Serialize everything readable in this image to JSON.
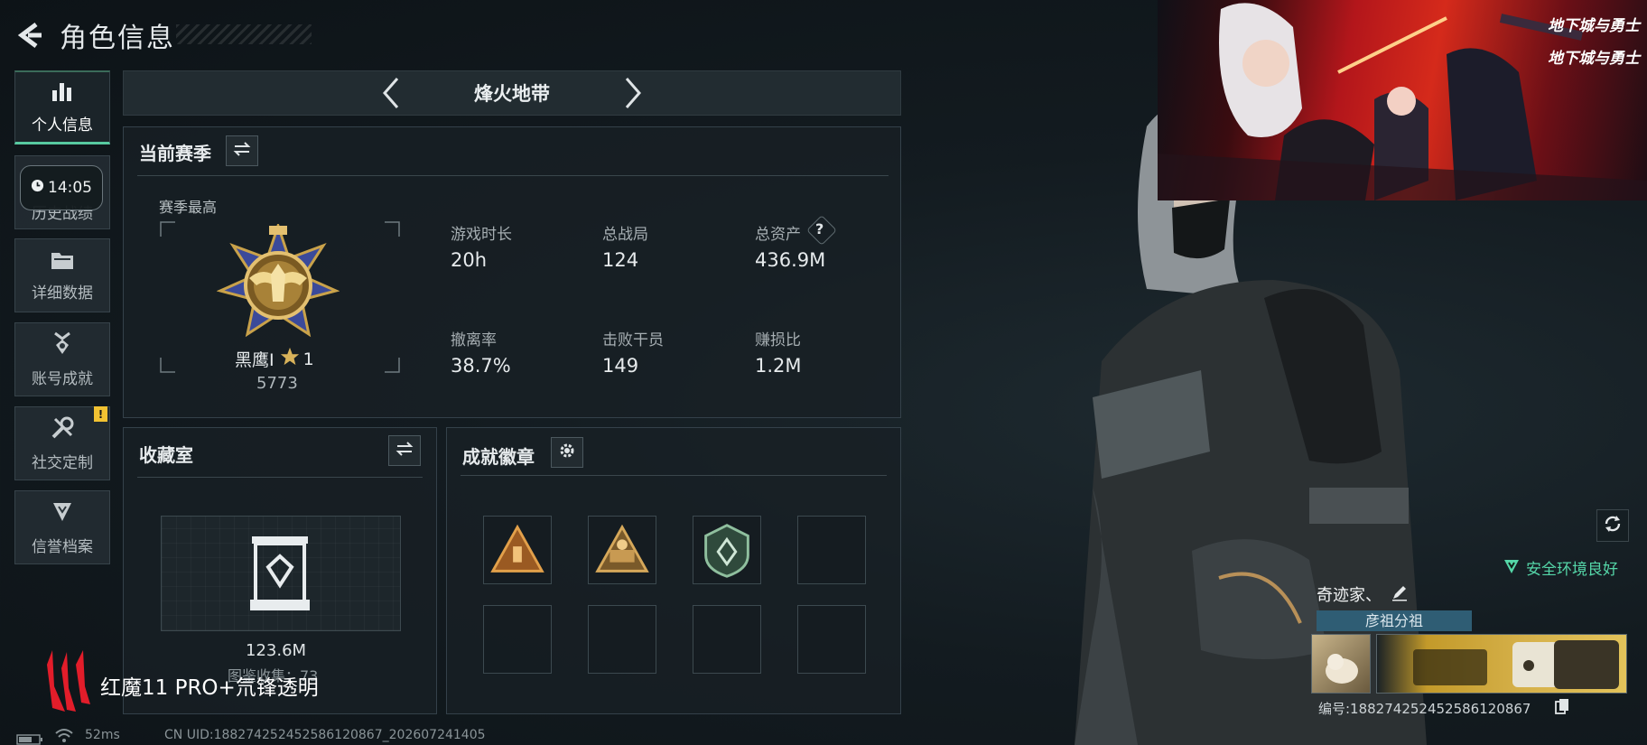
{
  "header": {
    "title": "角色信息"
  },
  "nav": {
    "items": [
      {
        "label": "个人信息",
        "icon": "bar-chart-icon"
      },
      {
        "label": "历史战绩",
        "icon": "clock-icon"
      },
      {
        "label": "详细数据",
        "icon": "folder-icon"
      },
      {
        "label": "账号成就",
        "icon": "medal-icon"
      },
      {
        "label": "社交定制",
        "icon": "wrench-icon"
      },
      {
        "label": "信誉档案",
        "icon": "shield-icon"
      }
    ],
    "clock_time": "14:05",
    "warn_badge": "!"
  },
  "map_bar": {
    "name": "烽火地带"
  },
  "season": {
    "title": "当前赛季",
    "best_label": "赛季最高",
    "rank_name": "黑鹰I",
    "rank_stars": "1",
    "rank_score": "5773",
    "stats": [
      {
        "label": "游戏时长",
        "value": "20h"
      },
      {
        "label": "总战局",
        "value": "124"
      },
      {
        "label": "总资产",
        "value": "436.9M"
      },
      {
        "label": "撤离率",
        "value": "38.7%"
      },
      {
        "label": "击败干员",
        "value": "149"
      },
      {
        "label": "赚损比",
        "value": "1.2M"
      }
    ],
    "help_mark": "?"
  },
  "collection": {
    "title": "收藏室",
    "value": "123.6M",
    "sub_label": "图鉴收集：73"
  },
  "achievements": {
    "title": "成就徽章"
  },
  "character": {
    "name": "奇迹家、",
    "guild": "彦祖分祖",
    "uid_label": "编号:18827425245258612086​7",
    "safety": "安全环境良好"
  },
  "promo": {
    "logo_text": "地下城与勇士"
  },
  "brand": {
    "text": "红魔11 PRO+氘锋透明"
  },
  "footer": {
    "ping": "52ms",
    "uid": "CN UID:18827425245258612086​7_202607241405"
  },
  "colors": {
    "accent_green": "#57c9a0",
    "safe_green": "#55d6a8",
    "warn_yellow": "#f2c232",
    "gold": "#c9a24a",
    "brand_red": "#e21d2a"
  }
}
